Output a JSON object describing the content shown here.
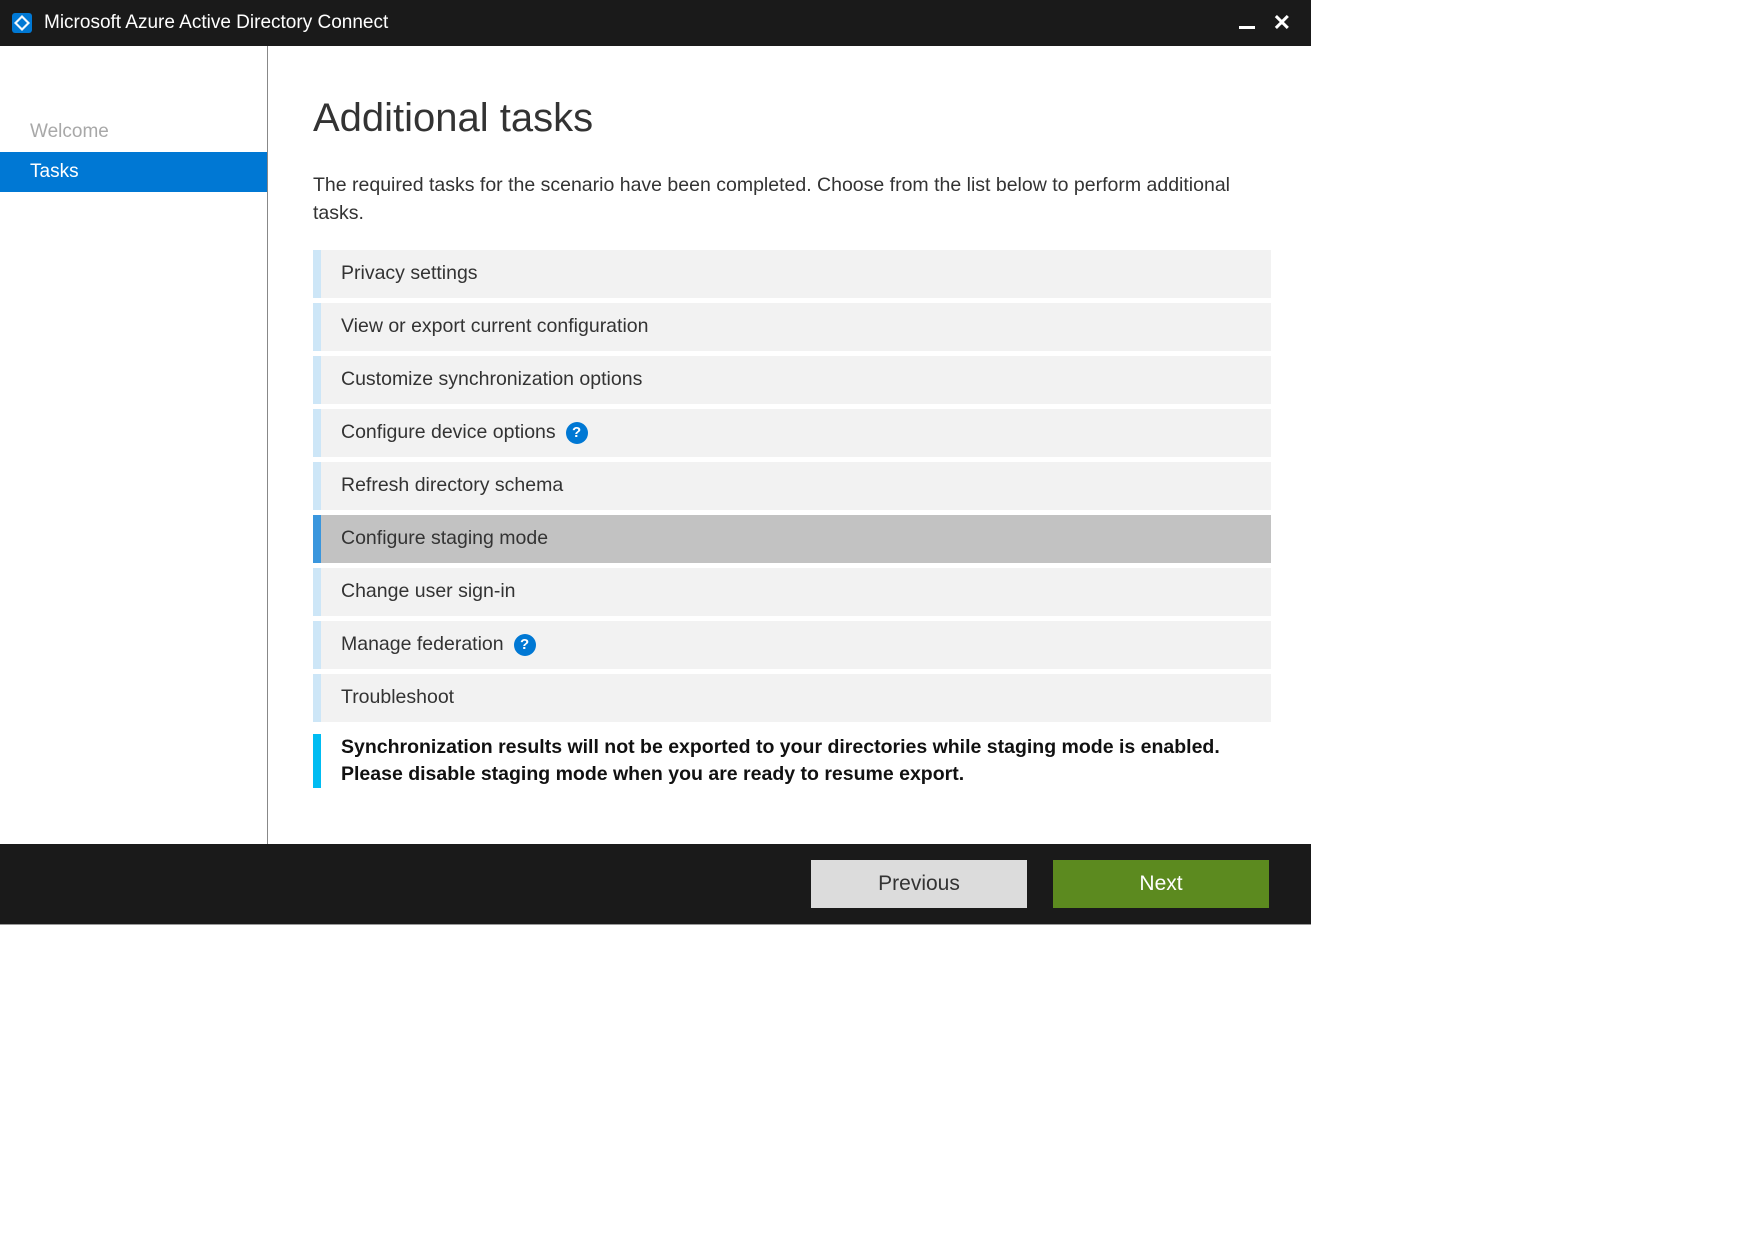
{
  "titlebar": {
    "title": "Microsoft Azure Active Directory Connect"
  },
  "sidebar": {
    "items": [
      {
        "label": "Welcome",
        "state": "disabled"
      },
      {
        "label": "Tasks",
        "state": "active"
      }
    ]
  },
  "content": {
    "title": "Additional tasks",
    "description": "The required tasks for the scenario have been completed. Choose from the list below to perform additional tasks.",
    "tasks": [
      {
        "label": "Privacy settings",
        "help": false,
        "selected": false
      },
      {
        "label": "View or export current configuration",
        "help": false,
        "selected": false
      },
      {
        "label": "Customize synchronization options",
        "help": false,
        "selected": false
      },
      {
        "label": "Configure device options",
        "help": true,
        "selected": false
      },
      {
        "label": "Refresh directory schema",
        "help": false,
        "selected": false
      },
      {
        "label": "Configure staging mode",
        "help": false,
        "selected": true
      },
      {
        "label": "Change user sign-in",
        "help": false,
        "selected": false
      },
      {
        "label": "Manage federation",
        "help": true,
        "selected": false
      },
      {
        "label": "Troubleshoot",
        "help": false,
        "selected": false
      }
    ],
    "info_banner": "Synchronization results will not be exported to your directories while staging mode is enabled. Please disable staging mode when you are ready to resume export."
  },
  "footer": {
    "previous_label": "Previous",
    "next_label": "Next"
  },
  "help_glyph": "?"
}
